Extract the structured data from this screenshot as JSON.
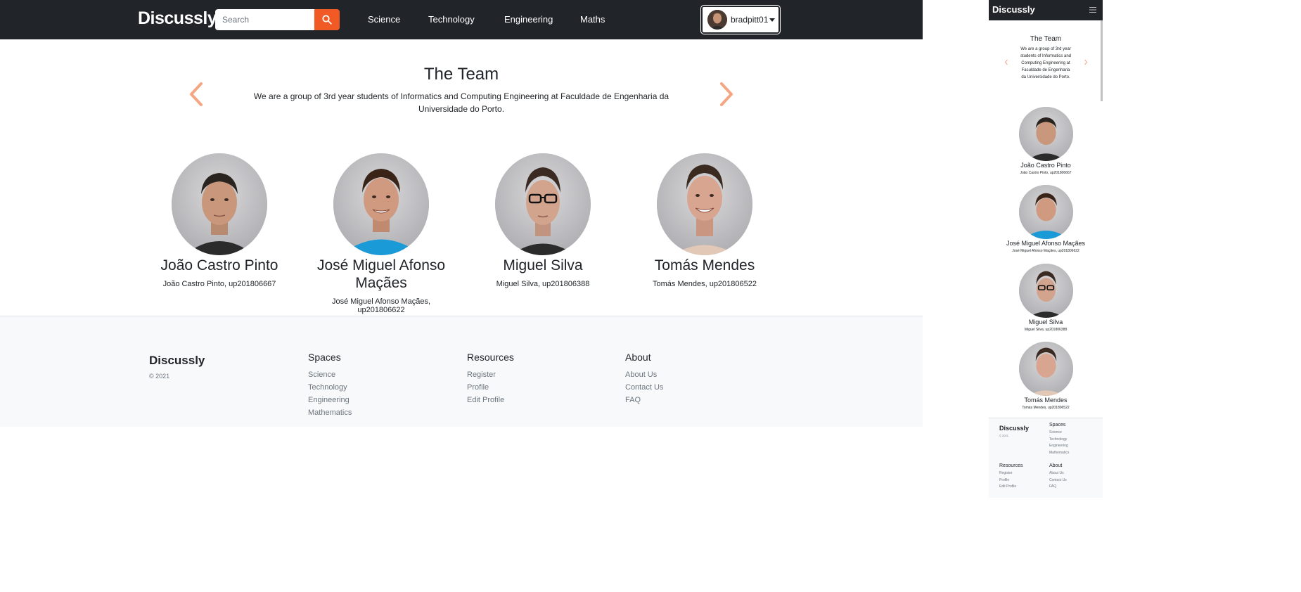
{
  "brand": "Discussly",
  "search": {
    "placeholder": "Search"
  },
  "nav": [
    {
      "label": "Science"
    },
    {
      "label": "Technology"
    },
    {
      "label": "Engineering"
    },
    {
      "label": "Maths"
    }
  ],
  "user": {
    "username": "bradpitt01"
  },
  "hero": {
    "title": "The Team",
    "description": "We are a group of 3rd year students of Informatics and Computing Engineering at Faculdade de Engenharia da Universidade do Porto."
  },
  "members": [
    {
      "name": "João Castro Pinto",
      "subtitle": "João Castro Pinto, up201806667"
    },
    {
      "name": "José Miguel Afonso Maçães",
      "subtitle": "José Miguel Afonso Maçães, up201806622"
    },
    {
      "name": "Miguel Silva",
      "subtitle": "Miguel Silva, up201806388"
    },
    {
      "name": "Tomás Mendes",
      "subtitle": "Tomás Mendes, up201806522"
    }
  ],
  "footer": {
    "brand": "Discussly",
    "copyright": "© 2021",
    "columns": [
      {
        "title": "Spaces",
        "links": [
          "Science",
          "Technology",
          "Engineering",
          "Mathematics"
        ]
      },
      {
        "title": "Resources",
        "links": [
          "Register",
          "Profile",
          "Edit Profile"
        ]
      },
      {
        "title": "About",
        "links": [
          "About Us",
          "Contact Us",
          "FAQ"
        ]
      }
    ]
  },
  "colors": {
    "navbar": "#212529",
    "accent": "#f15a24",
    "arrow": "#f4a582",
    "footer_bg": "#f8f9fa",
    "muted_text": "#6c757d"
  },
  "icons": {
    "search": "search-icon",
    "previous": "chevron-left-icon",
    "next": "chevron-right-icon",
    "user_menu": "caret-down-icon",
    "menu": "hamburger-icon"
  }
}
